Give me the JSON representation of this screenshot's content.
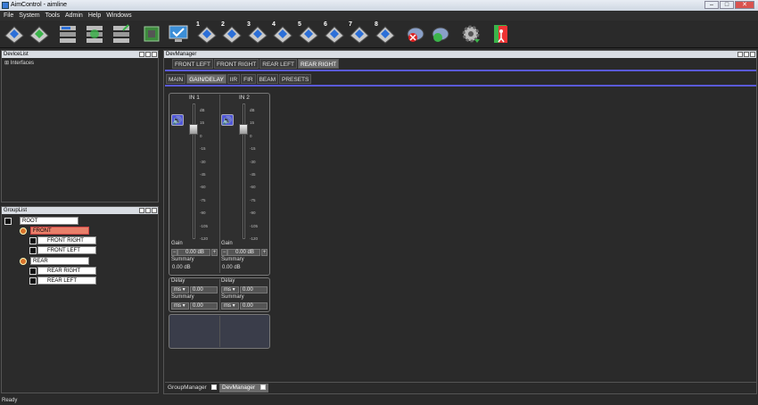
{
  "window": {
    "title": "AimControl - aimline",
    "min": "–",
    "max": "□",
    "close": "✕"
  },
  "menu": [
    "File",
    "System",
    "Tools",
    "Admin",
    "Help",
    "Windows"
  ],
  "toolbar": {
    "numbers": [
      "1",
      "2",
      "3",
      "4",
      "5",
      "6",
      "7",
      "8"
    ]
  },
  "devicelist": {
    "title": "DeviceList",
    "root": "Interfaces",
    "expander": "⊞"
  },
  "grouplist": {
    "title": "GroupList",
    "root": "ROOT",
    "front": "FRONT",
    "front_items": [
      "FRONT RIGHT",
      "FRONT LEFT"
    ],
    "rear": "REAR",
    "rear_items": [
      "REAR RIGHT",
      "REAR LEFT"
    ]
  },
  "devmanager": {
    "title": "DevManager",
    "device_tabs": [
      "FRONT LEFT",
      "FRONT RIGHT",
      "REAR LEFT",
      "REAR RIGHT"
    ],
    "sub_tabs": [
      "MAIN",
      "GAIN/DELAY",
      "IIR",
      "FIR",
      "BEAM",
      "PRESETS"
    ],
    "channels": [
      {
        "name": "IN 1",
        "gain_label": "Gain",
        "gain_value": "0.00 dB",
        "summary_label": "Summary",
        "summary_value": "0.00 dB",
        "delay_label": "Delay",
        "delay_unit": "ms",
        "delay_value": "0.00",
        "dsum_label": "Summary",
        "dsum_unit": "ms",
        "dsum_value": "0.00"
      },
      {
        "name": "IN 2",
        "gain_label": "Gain",
        "gain_value": "0.00 dB",
        "summary_label": "Summary",
        "summary_value": "0.00 dB",
        "delay_label": "Delay",
        "delay_unit": "ms",
        "delay_value": "0.00",
        "dsum_label": "Summary",
        "dsum_unit": "ms",
        "dsum_value": "0.00"
      }
    ],
    "scale": [
      "dB",
      "15",
      "0",
      "-15",
      "-30",
      "-45",
      "-60",
      "-75",
      "-90",
      "-105",
      "-120"
    ],
    "minus": "−",
    "plus": "+",
    "dropdown_arrow": "▾"
  },
  "bottom_tabs": [
    "GroupManager",
    "DevManager"
  ],
  "status": "Ready"
}
